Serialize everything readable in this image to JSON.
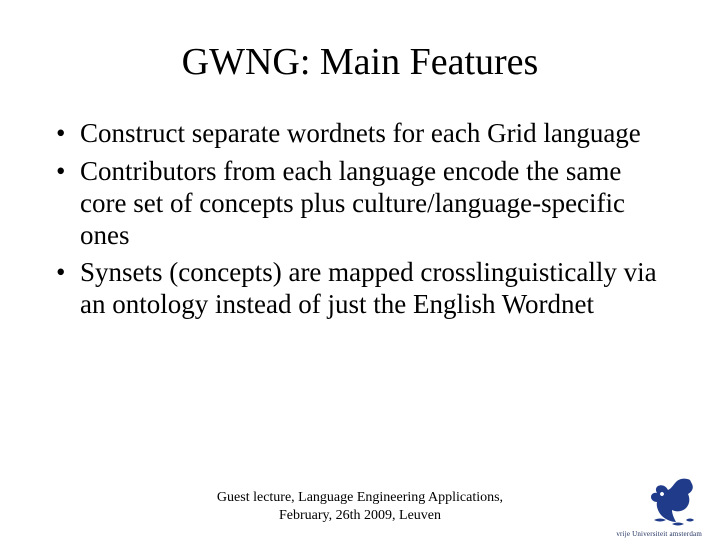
{
  "title": "GWNG: Main Features",
  "bullets": [
    "Construct separate wordnets for each Grid language",
    "Contributors from each language encode the same core set of concepts plus culture/language-specific ones",
    "Synsets (concepts) are mapped crosslinguistically via an ontology instead of just the English Wordnet"
  ],
  "footer": {
    "line1": "Guest lecture, Language Engineering Applications,",
    "line2": "February, 26th 2009, Leuven"
  },
  "logo": {
    "name": "griffin-icon",
    "text": "vrije Universiteit   amsterdam",
    "color": "#1f3b8a"
  }
}
